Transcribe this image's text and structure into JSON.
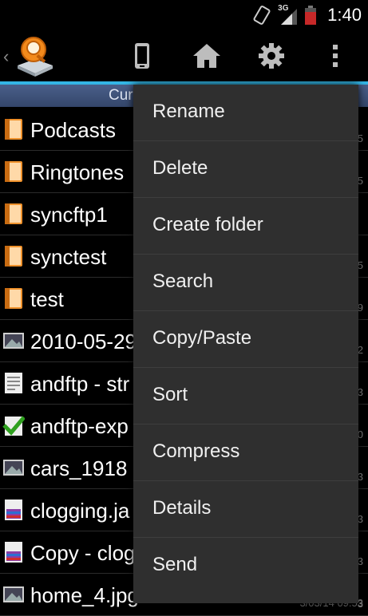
{
  "statusbar": {
    "network": "3G",
    "time": "1:40"
  },
  "pathbar": {
    "text": "Cur"
  },
  "files": [
    {
      "name": "Podcasts",
      "icon": "folder-icon",
      "meta": "5"
    },
    {
      "name": "Ringtones",
      "icon": "folder-icon",
      "meta": "5"
    },
    {
      "name": "syncftp1",
      "icon": "folder-icon",
      "meta": ""
    },
    {
      "name": "synctest",
      "icon": "folder-icon",
      "meta": "5"
    },
    {
      "name": "test",
      "icon": "folder-icon",
      "meta": "9"
    },
    {
      "name": "2010-05-29",
      "icon": "image-icon",
      "meta": "2"
    },
    {
      "name": "andftp - str",
      "icon": "document-icon",
      "meta": "3"
    },
    {
      "name": "andftp-exp",
      "icon": "checkmark-icon",
      "meta": "0"
    },
    {
      "name": "cars_1918",
      "icon": "image-icon",
      "meta": "3"
    },
    {
      "name": "clogging.ja",
      "icon": "archive-icon",
      "meta": "3"
    },
    {
      "name": "Copy - clog",
      "icon": "archive-icon",
      "meta": "3"
    },
    {
      "name": "home_4.jpg",
      "icon": "image-icon",
      "meta": "3"
    }
  ],
  "bottom_meta": "3/03/14 09:53",
  "menu": {
    "items": [
      {
        "label": "Rename"
      },
      {
        "label": "Delete"
      },
      {
        "label": "Create folder"
      },
      {
        "label": "Search"
      },
      {
        "label": "Copy/Paste"
      },
      {
        "label": "Sort"
      },
      {
        "label": "Compress"
      },
      {
        "label": "Details"
      },
      {
        "label": "Send"
      }
    ]
  },
  "colors": {
    "accent": "#33b5e5",
    "folder": "#f0922c",
    "menu_bg": "#2f2f2f"
  }
}
